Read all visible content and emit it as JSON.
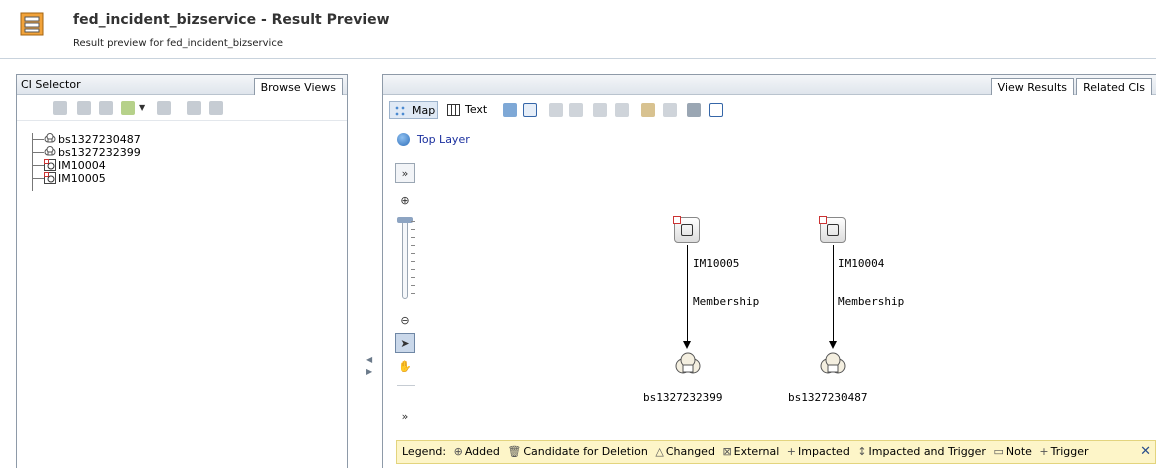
{
  "header": {
    "title": "fed_incident_bizservice - Result Preview",
    "subtitle": "Result preview for fed_incident_bizservice"
  },
  "left_panel": {
    "title": "CI Selector",
    "tab": "Browse Views",
    "tree": [
      {
        "label": "bs1327230487",
        "icon": "business-service-icon"
      },
      {
        "label": "bs1327232399",
        "icon": "business-service-icon"
      },
      {
        "label": "IM10004",
        "icon": "incident-icon"
      },
      {
        "label": "IM10005",
        "icon": "incident-icon"
      }
    ]
  },
  "right_panel": {
    "tabs": [
      "View Results",
      "Related CIs"
    ],
    "toolbar": {
      "map_label": "Map",
      "text_label": "Text"
    },
    "top_layer": "Top Layer",
    "graph": {
      "nodes": [
        {
          "label": "IM10005",
          "type": "incident"
        },
        {
          "label": "IM10004",
          "type": "incident"
        },
        {
          "label": "bs1327232399",
          "type": "business-service"
        },
        {
          "label": "bs1327230487",
          "type": "business-service"
        }
      ],
      "edges": [
        {
          "from": "IM10005",
          "to": "bs1327232399",
          "label": "Membership"
        },
        {
          "from": "IM10004",
          "to": "bs1327230487",
          "label": "Membership"
        }
      ]
    }
  },
  "legend": {
    "title": "Legend:",
    "items": [
      {
        "icon": "⊕",
        "label": "Added"
      },
      {
        "icon": "🗑",
        "label": "Candidate for Deletion"
      },
      {
        "icon": "△",
        "label": "Changed"
      },
      {
        "icon": "⊠",
        "label": "External"
      },
      {
        "icon": "+",
        "label": "Impacted"
      },
      {
        "icon": "↕",
        "label": "Impacted and Trigger"
      },
      {
        "icon": "▭",
        "label": "Note"
      },
      {
        "icon": "+",
        "label": "Trigger"
      }
    ],
    "close": "✕"
  }
}
